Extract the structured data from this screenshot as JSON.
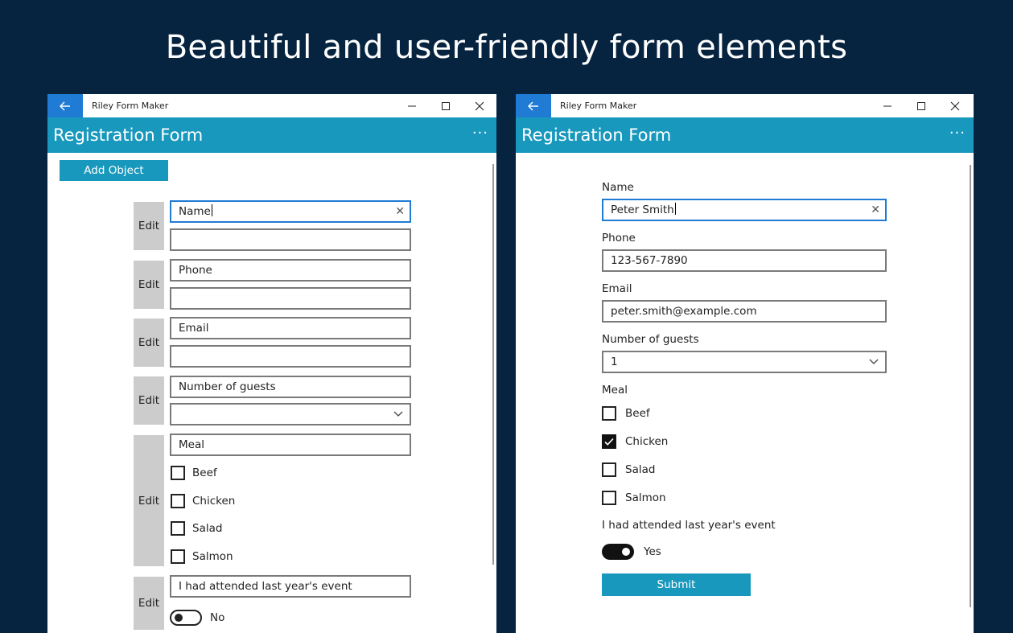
{
  "headline": "Beautiful and user-friendly form elements",
  "left_window": {
    "app_title": "Riley Form Maker",
    "form_title": "Registration Form",
    "more_label": "···",
    "add_object_label": "Add Object",
    "edit_label": "Edit",
    "fields": {
      "name_label": "Name",
      "phone_label": "Phone",
      "email_label": "Email",
      "guests_label": "Number of guests",
      "meal_label": "Meal",
      "meal_options": [
        "Beef",
        "Chicken",
        "Salad",
        "Salmon"
      ],
      "attended_label": "I had attended last year's event",
      "toggle_state": "No"
    }
  },
  "right_window": {
    "app_title": "Riley Form Maker",
    "form_title": "Registration Form",
    "more_label": "···",
    "name_label": "Name",
    "name_value": "Peter Smith",
    "phone_label": "Phone",
    "phone_value": "123-567-7890",
    "email_label": "Email",
    "email_value": "peter.smith@example.com",
    "guests_label": "Number of guests",
    "guests_value": "1",
    "meal_label": "Meal",
    "meal_options": [
      "Beef",
      "Chicken",
      "Salad",
      "Salmon"
    ],
    "meal_checked": [
      false,
      true,
      false,
      false
    ],
    "attended_label": "I had attended last year's event",
    "toggle_state": "Yes",
    "submit_label": "Submit"
  },
  "colors": {
    "background": "#06233f",
    "accent": "#1898bd",
    "back_button": "#1f7bd4"
  },
  "icons": [
    "back-arrow-icon",
    "minimize-icon",
    "maximize-icon",
    "close-icon",
    "clear-icon",
    "chevron-down-icon",
    "checkmark-icon"
  ]
}
